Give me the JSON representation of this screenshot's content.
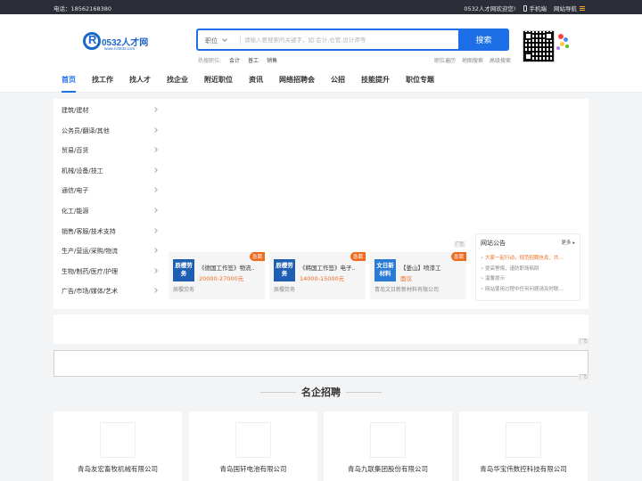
{
  "topbar": {
    "phone": "电话：18562168380",
    "welcome": "0532人才网欢迎您!",
    "mobile": "手机端",
    "site_nav": "网站导航"
  },
  "logo": {
    "text": "0532人才网",
    "url": "www.rc0532.com"
  },
  "search": {
    "type": "职位",
    "placeholder": "请输入要搜索的关键字，如:会计,仓管,设计师等",
    "button": "搜索"
  },
  "hot": {
    "label": "热搜职位:",
    "items": [
      "会计",
      "普工",
      "销售"
    ]
  },
  "quick_links": [
    "职位遍历",
    "地图搜索",
    "高级搜索"
  ],
  "nav": [
    "首页",
    "找工作",
    "找人才",
    "找企业",
    "附近职位",
    "资讯",
    "网络招聘会",
    "公招",
    "技能提升",
    "职位专题"
  ],
  "categories": [
    "建筑/建材",
    "公务员/翻译/其他",
    "贸易/百货",
    "机械/设备/技工",
    "通信/电子",
    "化工/能源",
    "销售/客服/技术支持",
    "生产/营运/采购/物流",
    "生物/制药/医疗/护理",
    "广告/市场/媒体/艺术"
  ],
  "ad_label": "广告",
  "jobs": [
    {
      "logo": "辰樱劳务",
      "title": "《德国工作签》物流…",
      "salary": "20000-27000元",
      "company": "辰樱劳务",
      "tag": "急聘"
    },
    {
      "logo": "辰樱劳务",
      "title": "《韩国工作签》电子…",
      "salary": "14000-15000元",
      "company": "辰樱劳务",
      "tag": "急聘"
    },
    {
      "logo": "文日新材料",
      "title": "【釜山】喷漆工",
      "salary": "面议",
      "company": "青岛文日新新材料有限公司",
      "tag": "急聘"
    }
  ],
  "notice": {
    "title": "网站公告",
    "more": "更多",
    "items": [
      "大家一起行动，规范招聘信息，共…",
      "提高警惕，谨防职场陷阱",
      "温馨提示",
      "网站使用过程中任何问题请及时联…"
    ]
  },
  "section_title": "名企招聘",
  "companies": [
    "青岛友宏畜牧机械有限公司",
    "青岛国轩电池有限公司",
    "青岛九联集团股份有限公司",
    "青岛华宝伟数控科技有限公司"
  ]
}
